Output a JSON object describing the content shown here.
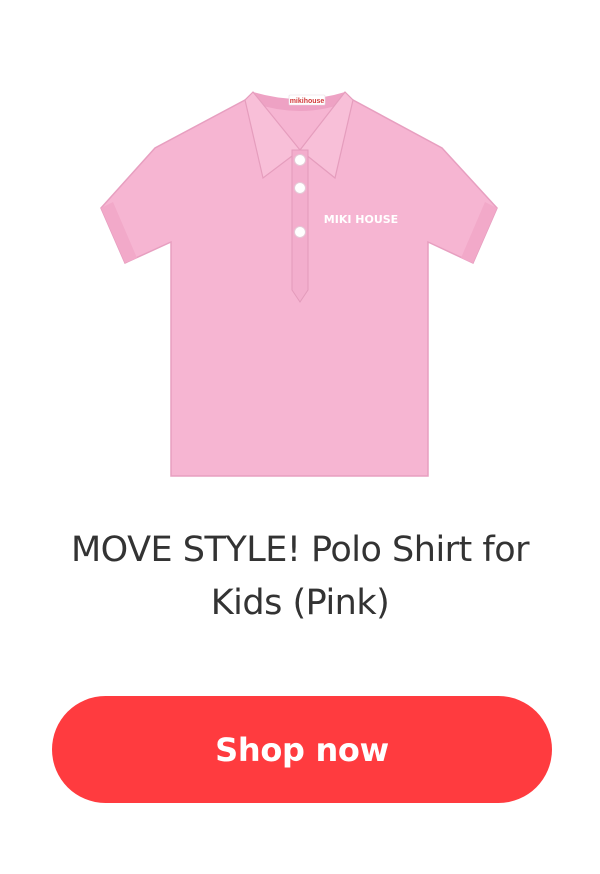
{
  "product": {
    "title": "MOVE STYLE! Polo Shirt for Kids (Pink)",
    "image_label": "MIKI HOUSE",
    "collar_tag": "mikihouse",
    "image_color": "#f7b6d3"
  },
  "cta": {
    "label": "Shop now",
    "color": "#ff3b3f"
  }
}
